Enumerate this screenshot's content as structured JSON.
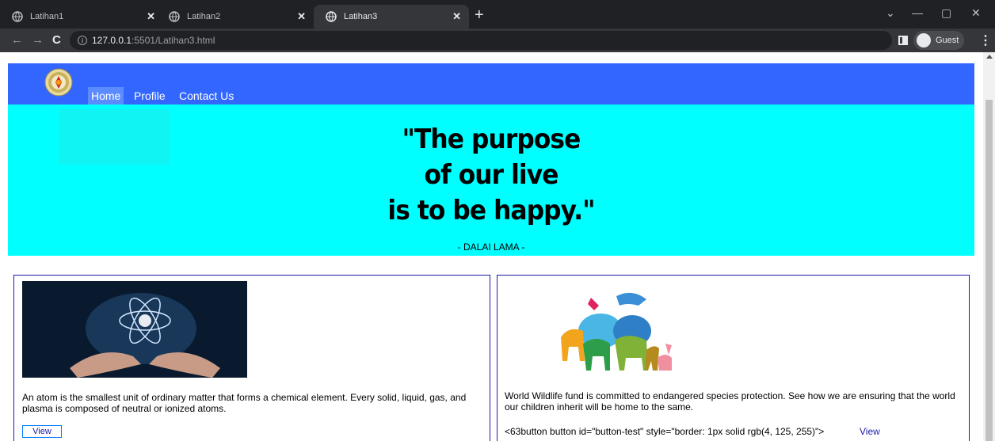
{
  "browser": {
    "tabs": [
      {
        "title": "Latihan1",
        "active": false
      },
      {
        "title": "Latihan2",
        "active": false
      },
      {
        "title": "Latihan3",
        "active": true
      }
    ],
    "new_tab_label": "+",
    "address": {
      "host": "127.0.0.1",
      "path": ":5501/Latihan3.html"
    },
    "profile_label": "Guest"
  },
  "nav": {
    "items": [
      {
        "label": "Home",
        "active": true
      },
      {
        "label": "Profile",
        "active": false
      },
      {
        "label": "Contact Us",
        "active": false
      }
    ]
  },
  "hero": {
    "quote_lines": [
      "\"The purpose",
      "of our live",
      "is to be happy.\""
    ],
    "author": "- DALAI LAMA -"
  },
  "cards": [
    {
      "text": "An atom is the smallest unit of ordinary matter that forms a chemical element. Every solid, liquid, gas, and plasma is composed of neutral or ionized atoms.",
      "button_label": "View"
    },
    {
      "text": "World Wildlife fund is committed to endangered species protection. See how we are ensuring that the world our children inherit will be home to the same.",
      "code_text": "<63button button id=\"button-test\" style=\"border: 1px solid rgb(4, 125, 255)\">",
      "link_label": "View"
    }
  ],
  "colors": {
    "navbar": "#3366ff",
    "nav_active": "#5b8cff",
    "hero": "#00ffff",
    "card_border": "#1a1aa6",
    "button_border": "#047dff"
  }
}
